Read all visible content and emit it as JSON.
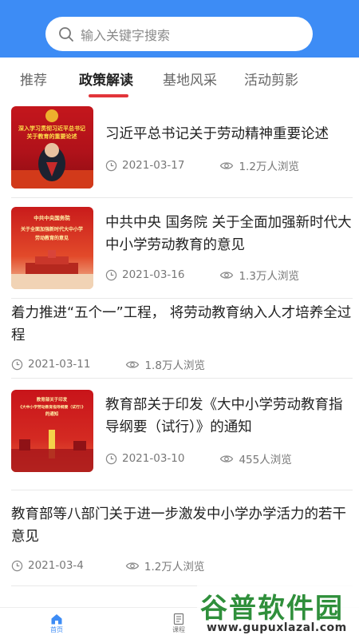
{
  "search": {
    "placeholder": "输入关键字搜索",
    "icon": "search-icon"
  },
  "tabs": [
    {
      "label": "推荐",
      "active": false
    },
    {
      "label": "政策解读",
      "active": true
    },
    {
      "label": "基地风采",
      "active": false
    },
    {
      "label": "活动剪影",
      "active": false
    }
  ],
  "articles": [
    {
      "title": "习近平总书记关于劳动精神重要论述",
      "date": "2021-03-17",
      "views": "1.2万人浏览",
      "thumb_lines": [
        "深入学习贯彻习近平总书记",
        "关于教育的重要论述"
      ]
    },
    {
      "title": "中共中央 国务院 关于全面加强新时代大中小学劳动教育的意见",
      "date": "2021-03-16",
      "views": "1.3万人浏览",
      "thumb_lines": [
        "中共中央国务院",
        "关于全面加强新时代大中小学",
        "劳动教育的意见"
      ]
    },
    {
      "title": "着力推进“五个一”工程， 将劳动教育纳入人才培养全过程",
      "date": "2021-03-11",
      "views": "1.8万人浏览"
    },
    {
      "title": "教育部关于印发《大中小学劳动教育指导纲要（试行）》的通知",
      "date": "2021-03-10",
      "views": "455人浏览",
      "thumb_lines": [
        "教育部关于印发",
        "《大中小学劳动教育指导纲要（试行）》",
        "的通知"
      ]
    },
    {
      "title": "教育部等八部门关于进一步激发中小学办学活力的若干意见",
      "date": "2021-03-4",
      "views": "1.2万人浏览"
    }
  ],
  "tabbar": [
    {
      "label": "首页",
      "icon": "home-icon",
      "active": true
    },
    {
      "label": "课程",
      "icon": "document-icon",
      "active": false
    }
  ],
  "watermark": {
    "big": "谷普软件园",
    "small": "www.gupuxlazal.com"
  },
  "colors": {
    "header": "#3d8cf5",
    "tab_indicator": "#e2353a",
    "active_tabbar": "#3d8cf5"
  }
}
